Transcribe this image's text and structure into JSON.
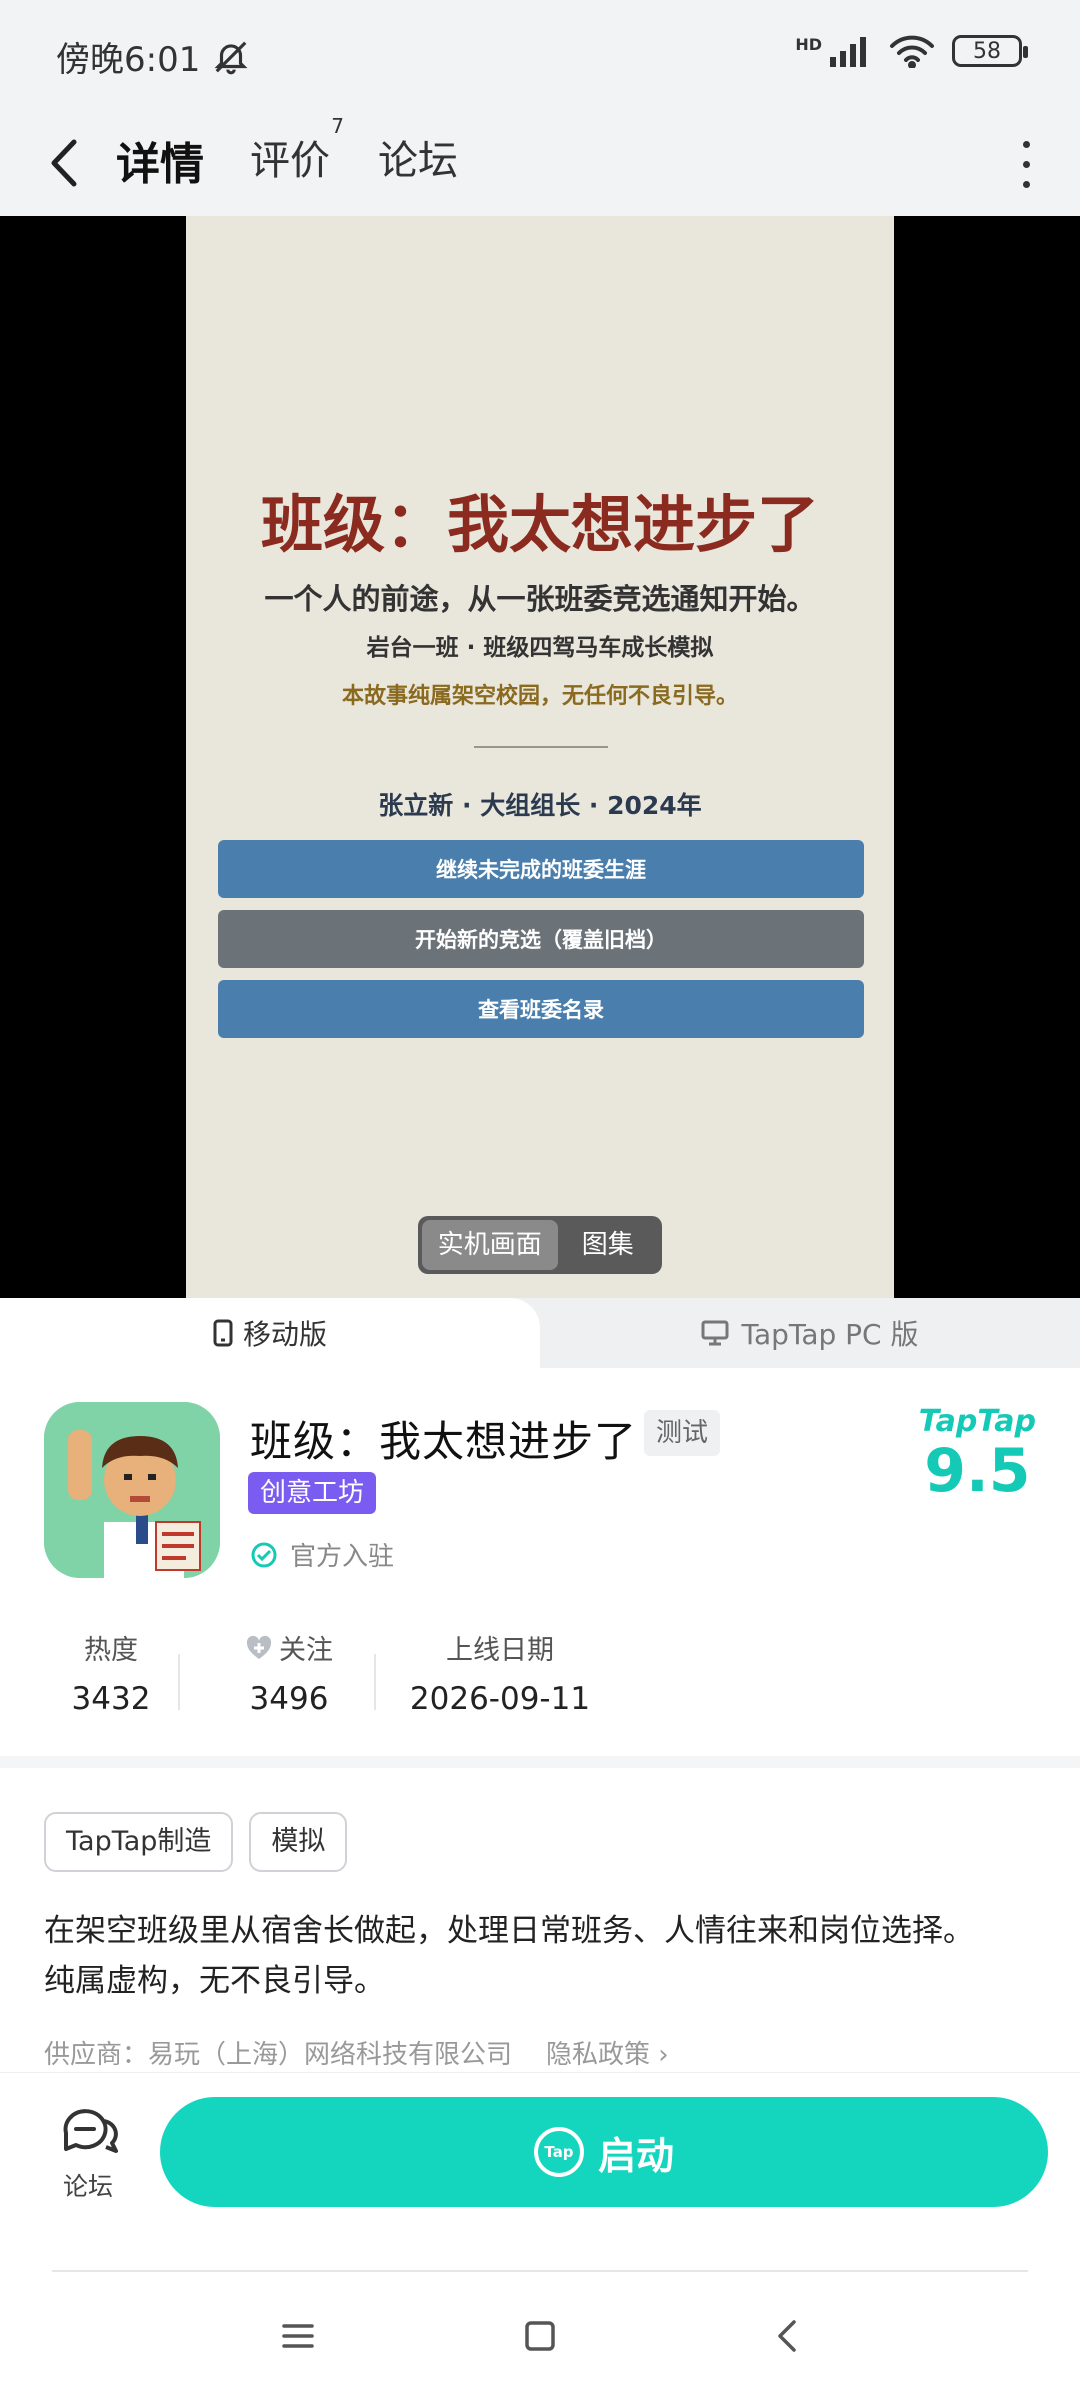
{
  "status_bar": {
    "time": "傍晚6:01",
    "network": "HD",
    "battery": "58"
  },
  "header": {
    "tabs": [
      {
        "label": "详情",
        "active": true
      },
      {
        "label": "评价",
        "badge": "7"
      },
      {
        "label": "论坛"
      }
    ]
  },
  "screenshot": {
    "title": "班级：我太想进步了",
    "tagline": "一个人的前途，从一张班委竞选通知开始。",
    "subtitle": "岩台一班 · 班级四驾马车成长模拟",
    "disclaimer": "本故事纯属架空校园，无任何不良引导。",
    "player_line": "张立新 · 大组组长 · 2024年",
    "buttons": [
      "继续未完成的班委生涯",
      "开始新的竞选（覆盖旧档）",
      "查看班委名录"
    ],
    "toggle": {
      "selected": "实机画面",
      "other": "图集"
    }
  },
  "platforms": {
    "mobile": "移动版",
    "pc": "TapTap PC 版"
  },
  "app": {
    "name": "班级：我太想进步了",
    "status_badge": "测试",
    "workshop_badge": "创意工坊",
    "official_label": "官方入驻",
    "rating_brand": "TapTap",
    "rating_score": "9.5"
  },
  "stats": [
    {
      "label": "热度",
      "value": "3432"
    },
    {
      "label": "关注",
      "value": "3496"
    },
    {
      "label": "上线日期",
      "value": "2026-09-11"
    }
  ],
  "tags": [
    "TapTap制造",
    "模拟"
  ],
  "description": {
    "line1": "在架空班级里从宿舍长做起，处理日常班务、人情往来和岗位选择。",
    "line2": "纯属虚构，无不良引导。"
  },
  "vendor": {
    "text": "供应商：易玩（上海）网络科技有限公司",
    "privacy": "隐私政策 ›"
  },
  "bottom": {
    "forum_label": "论坛",
    "launch_label": "启动",
    "tap_mark": "Tap"
  },
  "colors": {
    "accent": "#14d6bf",
    "workshop": "#7b5cf0",
    "title_red": "#8b2a1f"
  }
}
